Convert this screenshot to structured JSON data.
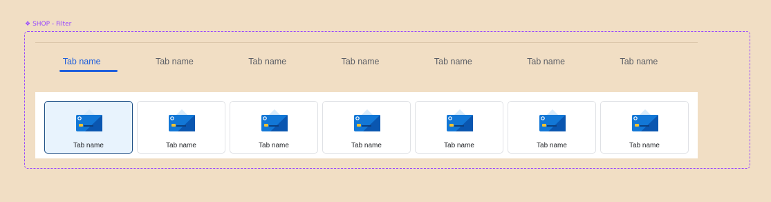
{
  "frame": {
    "label": "SHOP - Filter",
    "accent": "#9747ff"
  },
  "tabs": [
    {
      "label": "Tab name",
      "active": true
    },
    {
      "label": "Tab name",
      "active": false
    },
    {
      "label": "Tab name",
      "active": false
    },
    {
      "label": "Tab name",
      "active": false
    },
    {
      "label": "Tab name",
      "active": false
    },
    {
      "label": "Tab name",
      "active": false
    },
    {
      "label": "Tab name",
      "active": false
    }
  ],
  "cards": [
    {
      "label": "Tab name",
      "icon": "credit-card-icon",
      "selected": true
    },
    {
      "label": "Tab name",
      "icon": "credit-card-icon",
      "selected": false
    },
    {
      "label": "Tab name",
      "icon": "credit-card-icon",
      "selected": false
    },
    {
      "label": "Tab name",
      "icon": "credit-card-icon",
      "selected": false
    },
    {
      "label": "Tab name",
      "icon": "credit-card-icon",
      "selected": false
    },
    {
      "label": "Tab name",
      "icon": "credit-card-icon",
      "selected": false
    },
    {
      "label": "Tab name",
      "icon": "credit-card-icon",
      "selected": false
    }
  ],
  "colors": {
    "active_tab": "#1f5fdc",
    "background": "#f1dec4",
    "card_selected_bg": "#e8f3fd",
    "card_selected_border": "#1d4f86"
  }
}
